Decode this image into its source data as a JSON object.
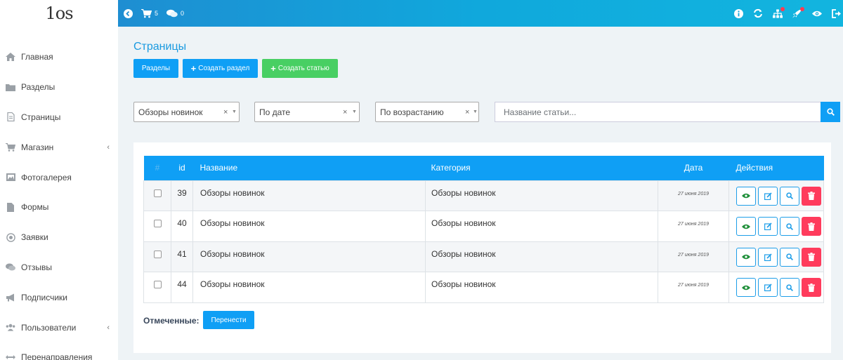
{
  "logo": {
    "text": "1os"
  },
  "topbar": {
    "cart_count": "5",
    "comments_count": "0"
  },
  "sidebar": {
    "items": [
      {
        "label": "Главная",
        "icon": "home-icon"
      },
      {
        "label": "Разделы",
        "icon": "folder-icon"
      },
      {
        "label": "Страницы",
        "icon": "file-icon"
      },
      {
        "label": "Магазин",
        "icon": "cart-icon",
        "has_submenu": true
      },
      {
        "label": "Фотогалерея",
        "icon": "image-icon"
      },
      {
        "label": "Формы",
        "icon": "document-icon"
      },
      {
        "label": "Заявки",
        "icon": "target-icon"
      },
      {
        "label": "Отзывы",
        "icon": "comments-icon"
      },
      {
        "label": "Подписчики",
        "icon": "megaphone-icon"
      },
      {
        "label": "Пользователи",
        "icon": "users-icon",
        "has_submenu": true
      },
      {
        "label": "Перенаправления",
        "icon": "arrows-icon"
      }
    ]
  },
  "main": {
    "title": "Страницы",
    "buttons": {
      "sections": "Разделы",
      "create_section": "Создать раздел",
      "create_article": "Создать статью"
    },
    "filters": {
      "category": "Обзоры новинок",
      "sort_by": "По дате",
      "order": "По возрастанию",
      "search_placeholder": "Название статьи..."
    },
    "table": {
      "headers": {
        "check": "#",
        "id": "id",
        "name": "Название",
        "category": "Категория",
        "date": "Дата",
        "actions": "Действия"
      },
      "rows": [
        {
          "id": "39",
          "name": "Обзоры новинок",
          "category": "Обзоры новинок",
          "date": "27 июня 2019"
        },
        {
          "id": "40",
          "name": "Обзоры новинок",
          "category": "Обзоры новинок",
          "date": "27 июня 2019"
        },
        {
          "id": "41",
          "name": "Обзоры новинок",
          "category": "Обзоры новинок",
          "date": "27 июня 2019"
        },
        {
          "id": "44",
          "name": "Обзоры новинок",
          "category": "Обзоры новинок",
          "date": "27 июня 2019"
        }
      ]
    },
    "bulk": {
      "label": "Отмеченные:",
      "move_button": "Перенести"
    }
  },
  "colors": {
    "primary": "#0f9ff5",
    "success": "#48cf63",
    "danger": "#ff3b5c",
    "title": "#1a9ae0"
  }
}
